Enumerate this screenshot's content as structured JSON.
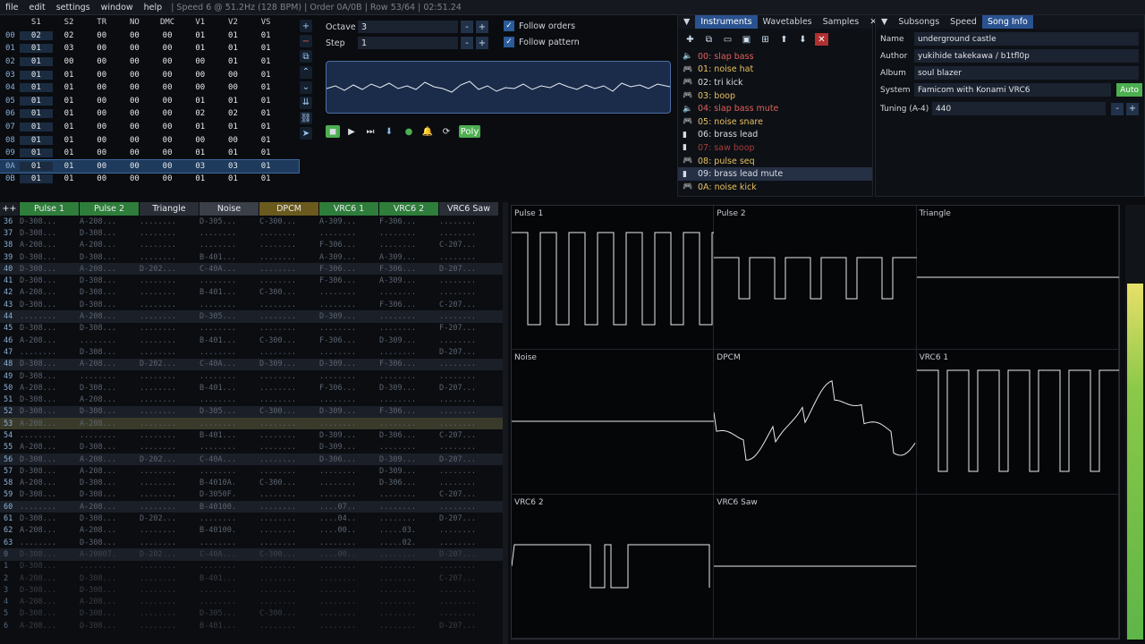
{
  "menu": {
    "items": [
      "file",
      "edit",
      "settings",
      "window",
      "help"
    ],
    "status": "| Speed 6 @ 51.2Hz (128 BPM) | Order 0A/0B | Row 53/64 | 02:51.24"
  },
  "orders": {
    "headers": [
      "S1",
      "S2",
      "TR",
      "NO",
      "DMC",
      "V1",
      "V2",
      "VS"
    ],
    "rows": [
      {
        "n": "00",
        "v": [
          "02",
          "02",
          "00",
          "00",
          "00",
          "01",
          "01",
          "01"
        ]
      },
      {
        "n": "01",
        "v": [
          "01",
          "03",
          "00",
          "00",
          "00",
          "01",
          "01",
          "01"
        ]
      },
      {
        "n": "02",
        "v": [
          "01",
          "00",
          "00",
          "00",
          "00",
          "00",
          "01",
          "01"
        ]
      },
      {
        "n": "03",
        "v": [
          "01",
          "01",
          "00",
          "00",
          "00",
          "00",
          "00",
          "01"
        ]
      },
      {
        "n": "04",
        "v": [
          "01",
          "01",
          "00",
          "00",
          "00",
          "00",
          "00",
          "01"
        ]
      },
      {
        "n": "05",
        "v": [
          "01",
          "01",
          "00",
          "00",
          "00",
          "01",
          "01",
          "01"
        ]
      },
      {
        "n": "06",
        "v": [
          "01",
          "01",
          "00",
          "00",
          "00",
          "02",
          "02",
          "01"
        ]
      },
      {
        "n": "07",
        "v": [
          "01",
          "01",
          "00",
          "00",
          "00",
          "01",
          "01",
          "01"
        ]
      },
      {
        "n": "08",
        "v": [
          "01",
          "01",
          "00",
          "00",
          "00",
          "00",
          "00",
          "01"
        ]
      },
      {
        "n": "09",
        "v": [
          "01",
          "01",
          "00",
          "00",
          "00",
          "01",
          "01",
          "01"
        ]
      },
      {
        "n": "0A",
        "v": [
          "01",
          "01",
          "00",
          "00",
          "00",
          "03",
          "03",
          "01"
        ]
      },
      {
        "n": "0B",
        "v": [
          "01",
          "01",
          "00",
          "00",
          "00",
          "01",
          "01",
          "01"
        ]
      }
    ]
  },
  "edit": {
    "octave_label": "Octave",
    "octave": "3",
    "step_label": "Step",
    "step": "1",
    "follow_orders": "Follow orders",
    "follow_pattern": "Follow pattern",
    "poly": "Poly"
  },
  "instruments": {
    "tabs": [
      "Instruments",
      "Wavetables",
      "Samples"
    ],
    "items": [
      {
        "label": "00: slap bass",
        "color": "#e0605a",
        "icon": "speaker-icon"
      },
      {
        "label": "01: noise hat",
        "color": "#e8c060",
        "icon": "gamepad-icon"
      },
      {
        "label": "02: tri kick",
        "color": "#d8dde4",
        "icon": "gamepad-icon"
      },
      {
        "label": "03: boop",
        "color": "#e8c060",
        "icon": "gamepad-icon"
      },
      {
        "label": "04: slap bass mute",
        "color": "#e0605a",
        "icon": "speaker-icon"
      },
      {
        "label": "05: noise snare",
        "color": "#e8c060",
        "icon": "gamepad-icon"
      },
      {
        "label": "06: brass lead",
        "color": "#d8dde4",
        "icon": "bars-icon"
      },
      {
        "label": "07: saw boop",
        "color": "#a83c3c",
        "icon": "bars-icon"
      },
      {
        "label": "08: pulse seq",
        "color": "#e8c060",
        "icon": "gamepad-icon"
      },
      {
        "label": "09: brass lead mute",
        "color": "#d8dde4",
        "icon": "bars-icon"
      },
      {
        "label": "0A: noise kick",
        "color": "#e8c060",
        "icon": "gamepad-icon"
      }
    ]
  },
  "songinfo": {
    "tabs": [
      "Subsongs",
      "Speed",
      "Song Info"
    ],
    "name_label": "Name",
    "name": "underground castle",
    "author_label": "Author",
    "author": "yukihide takekawa / b1tfl0p",
    "album_label": "Album",
    "album": "soul blazer",
    "system_label": "System",
    "system": "Famicom with Konami VRC6",
    "auto": "Auto",
    "tuning_label": "Tuning (A-4)",
    "tuning": "440"
  },
  "pattern": {
    "corner": "++",
    "channels": [
      {
        "name": "Pulse 1",
        "color": "#2e7d3a"
      },
      {
        "name": "Pulse 2",
        "color": "#2e7d3a"
      },
      {
        "name": "Triangle",
        "color": "#2a2e36"
      },
      {
        "name": "Noise",
        "color": "#3a3f48"
      },
      {
        "name": "DPCM",
        "color": "#6b5a1e"
      },
      {
        "name": "VRC6 1",
        "color": "#2e7d3a"
      },
      {
        "name": "VRC6 2",
        "color": "#2e7d3a"
      },
      {
        "name": "VRC6 Saw",
        "color": "#2a2e36"
      }
    ],
    "rows": [
      {
        "n": "36",
        "c": [
          "D-308...",
          "A-208...",
          "........",
          "D-305...",
          "C-300...",
          "A-309...",
          "F-306...",
          "........"
        ]
      },
      {
        "n": "37",
        "c": [
          "D-308...",
          "D-308...",
          "........",
          "........",
          "........",
          "........",
          "........",
          "........"
        ]
      },
      {
        "n": "38",
        "c": [
          "A-208...",
          "A-208...",
          "........",
          "........",
          "........",
          "F-306...",
          "........",
          "C-207..."
        ]
      },
      {
        "n": "39",
        "c": [
          "D-308...",
          "D-308...",
          "........",
          "B-401...",
          "........",
          "A-309...",
          "A-309...",
          "........"
        ]
      },
      {
        "n": "40",
        "c": [
          "D-308...",
          "A-208...",
          "D-202...",
          "C-40A...",
          "........",
          "F-306...",
          "F-306...",
          "D-207..."
        ]
      },
      {
        "n": "41",
        "c": [
          "D-308...",
          "D-308...",
          "........",
          "........",
          "........",
          "F-306...",
          "A-309...",
          "........"
        ]
      },
      {
        "n": "42",
        "c": [
          "A-208...",
          "D-308...",
          "........",
          "B-401...",
          "C-300...",
          "........",
          "........",
          "........"
        ]
      },
      {
        "n": "43",
        "c": [
          "D-308...",
          "D-308...",
          "........",
          "........",
          "........",
          "........",
          "F-306...",
          "C-207..."
        ]
      },
      {
        "n": "44",
        "c": [
          "........",
          "A-208...",
          "........",
          "D-305...",
          "........",
          "D-309...",
          "........",
          "........"
        ]
      },
      {
        "n": "45",
        "c": [
          "D-308...",
          "D-308...",
          "........",
          "........",
          "........",
          "........",
          "........",
          "F-207..."
        ]
      },
      {
        "n": "46",
        "c": [
          "A-208...",
          "........",
          "........",
          "B-401...",
          "C-300...",
          "F-306...",
          "D-309...",
          "........"
        ]
      },
      {
        "n": "47",
        "c": [
          "........",
          "D-308...",
          "........",
          "........",
          "........",
          "........",
          "........",
          "D-207..."
        ]
      },
      {
        "n": "48",
        "c": [
          "D-308...",
          "A-208...",
          "D-202...",
          "C-40A...",
          "D-309...",
          "D-309...",
          "F-306...",
          "........"
        ]
      },
      {
        "n": "49",
        "c": [
          "D-308...",
          "........",
          "........",
          "........",
          "........",
          "........",
          "........",
          "........"
        ]
      },
      {
        "n": "50",
        "c": [
          "A-208...",
          "D-308...",
          "........",
          "B-401...",
          "........",
          "F-306...",
          "D-309...",
          "D-207..."
        ]
      },
      {
        "n": "51",
        "c": [
          "D-308...",
          "A-208...",
          "........",
          "........",
          "........",
          "........",
          "........",
          "........"
        ]
      },
      {
        "n": "52",
        "c": [
          "D-308...",
          "D-308...",
          "........",
          "D-305...",
          "C-300...",
          "D-309...",
          "F-306...",
          "........"
        ]
      },
      {
        "n": "53",
        "c": [
          "A-208...",
          "A-208...",
          "........",
          "........",
          "........",
          "........",
          "........",
          "........"
        ]
      },
      {
        "n": "54",
        "c": [
          "........",
          "........",
          "........",
          "B-401...",
          "........",
          "D-309...",
          "D-306...",
          "C-207..."
        ]
      },
      {
        "n": "55",
        "c": [
          "A-208...",
          "D-308...",
          "........",
          "........",
          "........",
          "D-309...",
          "........",
          "........"
        ]
      },
      {
        "n": "56",
        "c": [
          "D-308...",
          "A-208...",
          "D-202...",
          "C-40A...",
          "........",
          "D-306...",
          "D-309...",
          "D-207..."
        ]
      },
      {
        "n": "57",
        "c": [
          "D-308...",
          "A-208...",
          "........",
          "........",
          "........",
          "........",
          "D-309...",
          "........"
        ]
      },
      {
        "n": "58",
        "c": [
          "A-208...",
          "D-308...",
          "........",
          "B-4010A.",
          "C-300...",
          "........",
          "D-306...",
          "........"
        ]
      },
      {
        "n": "59",
        "c": [
          "D-308...",
          "D-308...",
          "........",
          "D-3050F.",
          "........",
          "........",
          "........",
          "C-207..."
        ]
      },
      {
        "n": "60",
        "c": [
          "........",
          "A-208...",
          "........",
          "B-40100.",
          "........",
          "....07..",
          "........",
          "........"
        ]
      },
      {
        "n": "61",
        "c": [
          "D-308...",
          "D-308...",
          "D-202...",
          "........",
          "........",
          "....04..",
          "........",
          "D-207..."
        ]
      },
      {
        "n": "62",
        "c": [
          "A-208...",
          "A-208...",
          "........",
          "B-40100.",
          "........",
          "....00..",
          ".....03.",
          "........"
        ]
      },
      {
        "n": "63",
        "c": [
          "........",
          "D-308...",
          "........",
          "........",
          "........",
          "........",
          ".....02.",
          "........"
        ]
      },
      {
        "n": "0",
        "c": [
          "D-308...",
          "A-20807.",
          "D-202...",
          "C-40A...",
          "C-300...",
          "....00..",
          "........",
          "D-207..."
        ]
      },
      {
        "n": "1",
        "c": [
          "D-308...",
          "........",
          "........",
          "........",
          "........",
          "........",
          "........",
          "........"
        ]
      },
      {
        "n": "2",
        "c": [
          "A-208...",
          "D-308...",
          "........",
          "B-401...",
          "........",
          "........",
          "........",
          "C-207..."
        ]
      },
      {
        "n": "3",
        "c": [
          "D-308...",
          "D-308...",
          "........",
          "........",
          "........",
          "........",
          "........",
          "........"
        ]
      },
      {
        "n": "4",
        "c": [
          "A-208...",
          "A-208...",
          "........",
          "........",
          "........",
          "........",
          "........",
          "........"
        ]
      },
      {
        "n": "5",
        "c": [
          "D-308...",
          "D-308...",
          "........",
          "D-305...",
          "C-300...",
          "........",
          "........",
          "........"
        ]
      },
      {
        "n": "6",
        "c": [
          "A-208...",
          "D-308...",
          "........",
          "B-401...",
          "........",
          "........",
          "........",
          "D-207..."
        ]
      }
    ]
  },
  "scopes": {
    "labels": [
      "Pulse 1",
      "Pulse 2",
      "Triangle",
      "Noise",
      "DPCM",
      "VRC6 1",
      "VRC6 2",
      "VRC6 Saw",
      ""
    ]
  }
}
